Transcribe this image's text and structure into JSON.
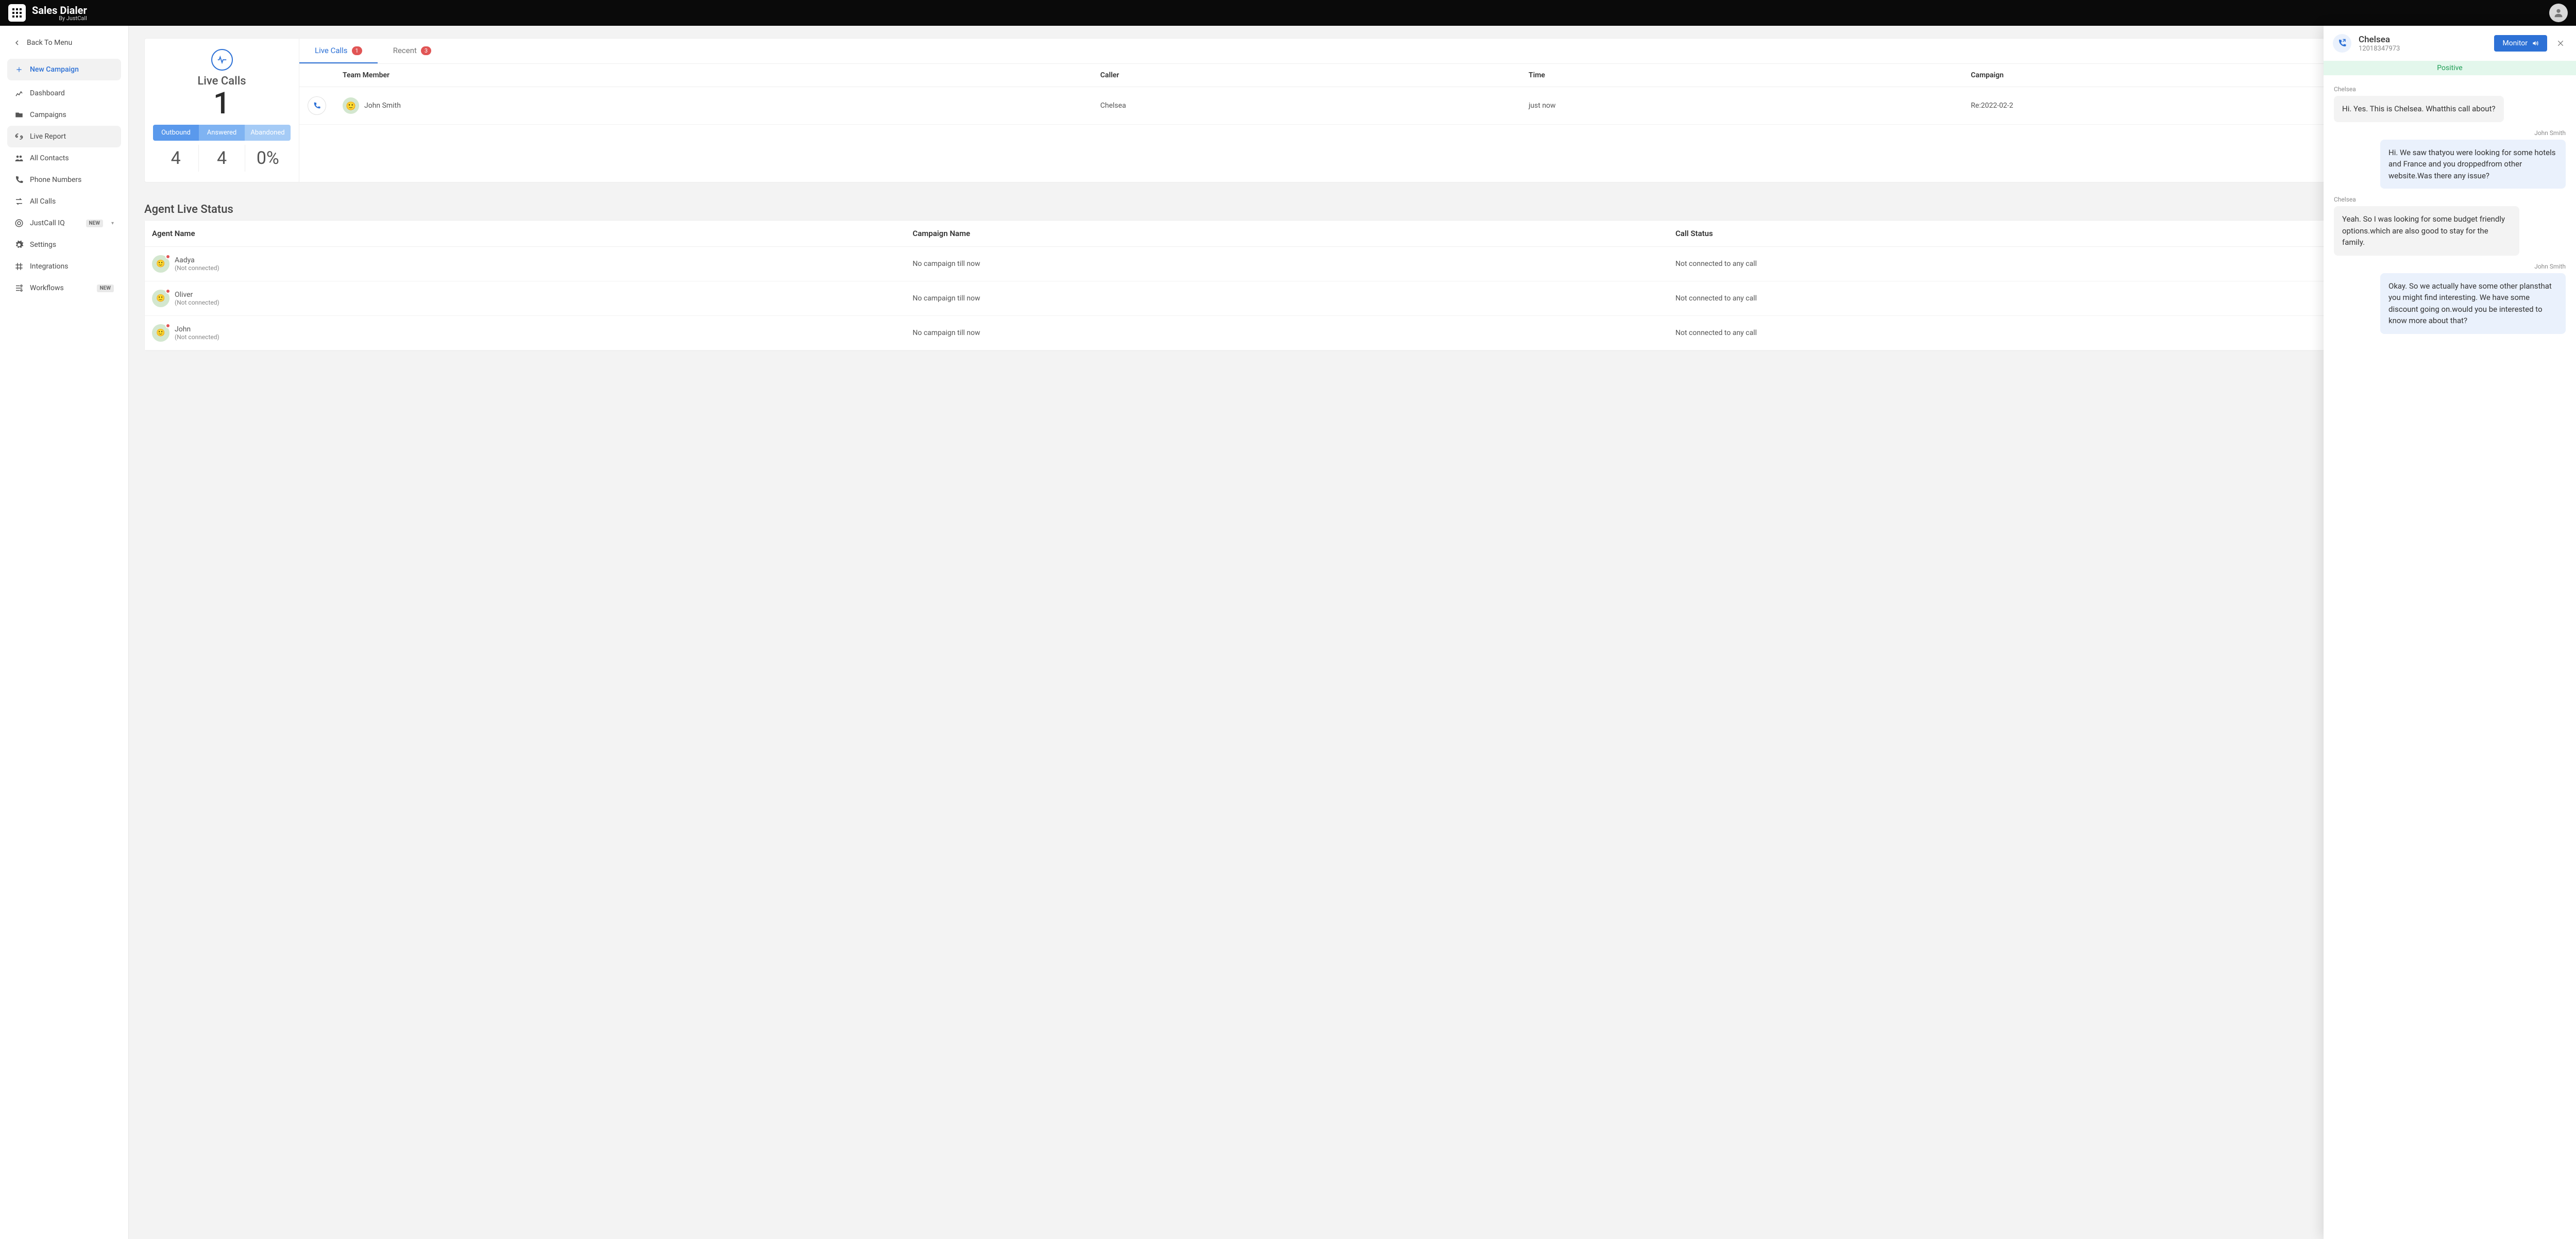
{
  "brand": {
    "name": "Sales Dialer",
    "by": "By JustCall"
  },
  "sidebar": {
    "back": "Back To Menu",
    "new_campaign": "New Campaign",
    "new_badge": "NEW",
    "items": [
      {
        "label": "Dashboard"
      },
      {
        "label": "Campaigns"
      },
      {
        "label": "Live Report",
        "active": true
      },
      {
        "label": "All Contacts"
      },
      {
        "label": "Phone Numbers"
      },
      {
        "label": "All Calls"
      },
      {
        "label": "JustCall IQ",
        "new": true,
        "chevron": true
      },
      {
        "label": "Settings"
      },
      {
        "label": "Integrations"
      },
      {
        "label": "Workflows",
        "new": true
      }
    ]
  },
  "live_calls": {
    "title": "Live Calls",
    "count": "1",
    "seg": {
      "outbound": "Outbound",
      "answered": "Answered",
      "abandoned": "Abandoned"
    },
    "trio": {
      "outbound": "4",
      "answered": "4",
      "abandoned": "0%"
    },
    "tabs": {
      "live": {
        "label": "Live Calls",
        "badge": "1"
      },
      "recent": {
        "label": "Recent",
        "badge": "3"
      }
    },
    "columns": {
      "member": "Team Member",
      "caller": "Caller",
      "time": "Time",
      "campaign": "Campaign"
    },
    "rows": [
      {
        "member": "John Smith",
        "caller": "Chelsea",
        "time": "just now",
        "campaign": "Re:2022-02-2"
      }
    ]
  },
  "agent_status": {
    "title": "Agent Live Status",
    "columns": {
      "name": "Agent Name",
      "campaign": "Campaign Name",
      "status": "Call Status"
    },
    "rows": [
      {
        "name": "Aadya",
        "sub": "(Not connected)",
        "campaign": "No campaign till now",
        "status": "Not connected to any call"
      },
      {
        "name": "Oliver",
        "sub": "(Not connected)",
        "campaign": "No campaign till now",
        "status": "Not connected to any call"
      },
      {
        "name": "John",
        "sub": "(Not connected)",
        "campaign": "No campaign till now",
        "status": "Not connected to any call"
      }
    ]
  },
  "transcript": {
    "name": "Chelsea",
    "phone": "12018347973",
    "monitor": "Monitor",
    "sentiment": "Positive",
    "messages": [
      {
        "side": "left",
        "speaker": "Chelsea",
        "text": "Hi. Yes. This is Chelsea. Whatthis call about?"
      },
      {
        "side": "right",
        "speaker": "John Smith",
        "text": "Hi. We saw thatyou were looking for some hotels and France and you droppedfrom other website.Was there any issue?"
      },
      {
        "side": "left",
        "speaker": "Chelsea",
        "text": "Yeah. So I was looking for some budget friendly options.which are also good to stay for the family."
      },
      {
        "side": "right",
        "speaker": "John Smith",
        "text": "Okay. So we actually have some other plansthat you might find interesting. We have some discount going on.would you be interested to know more about that?"
      }
    ]
  }
}
